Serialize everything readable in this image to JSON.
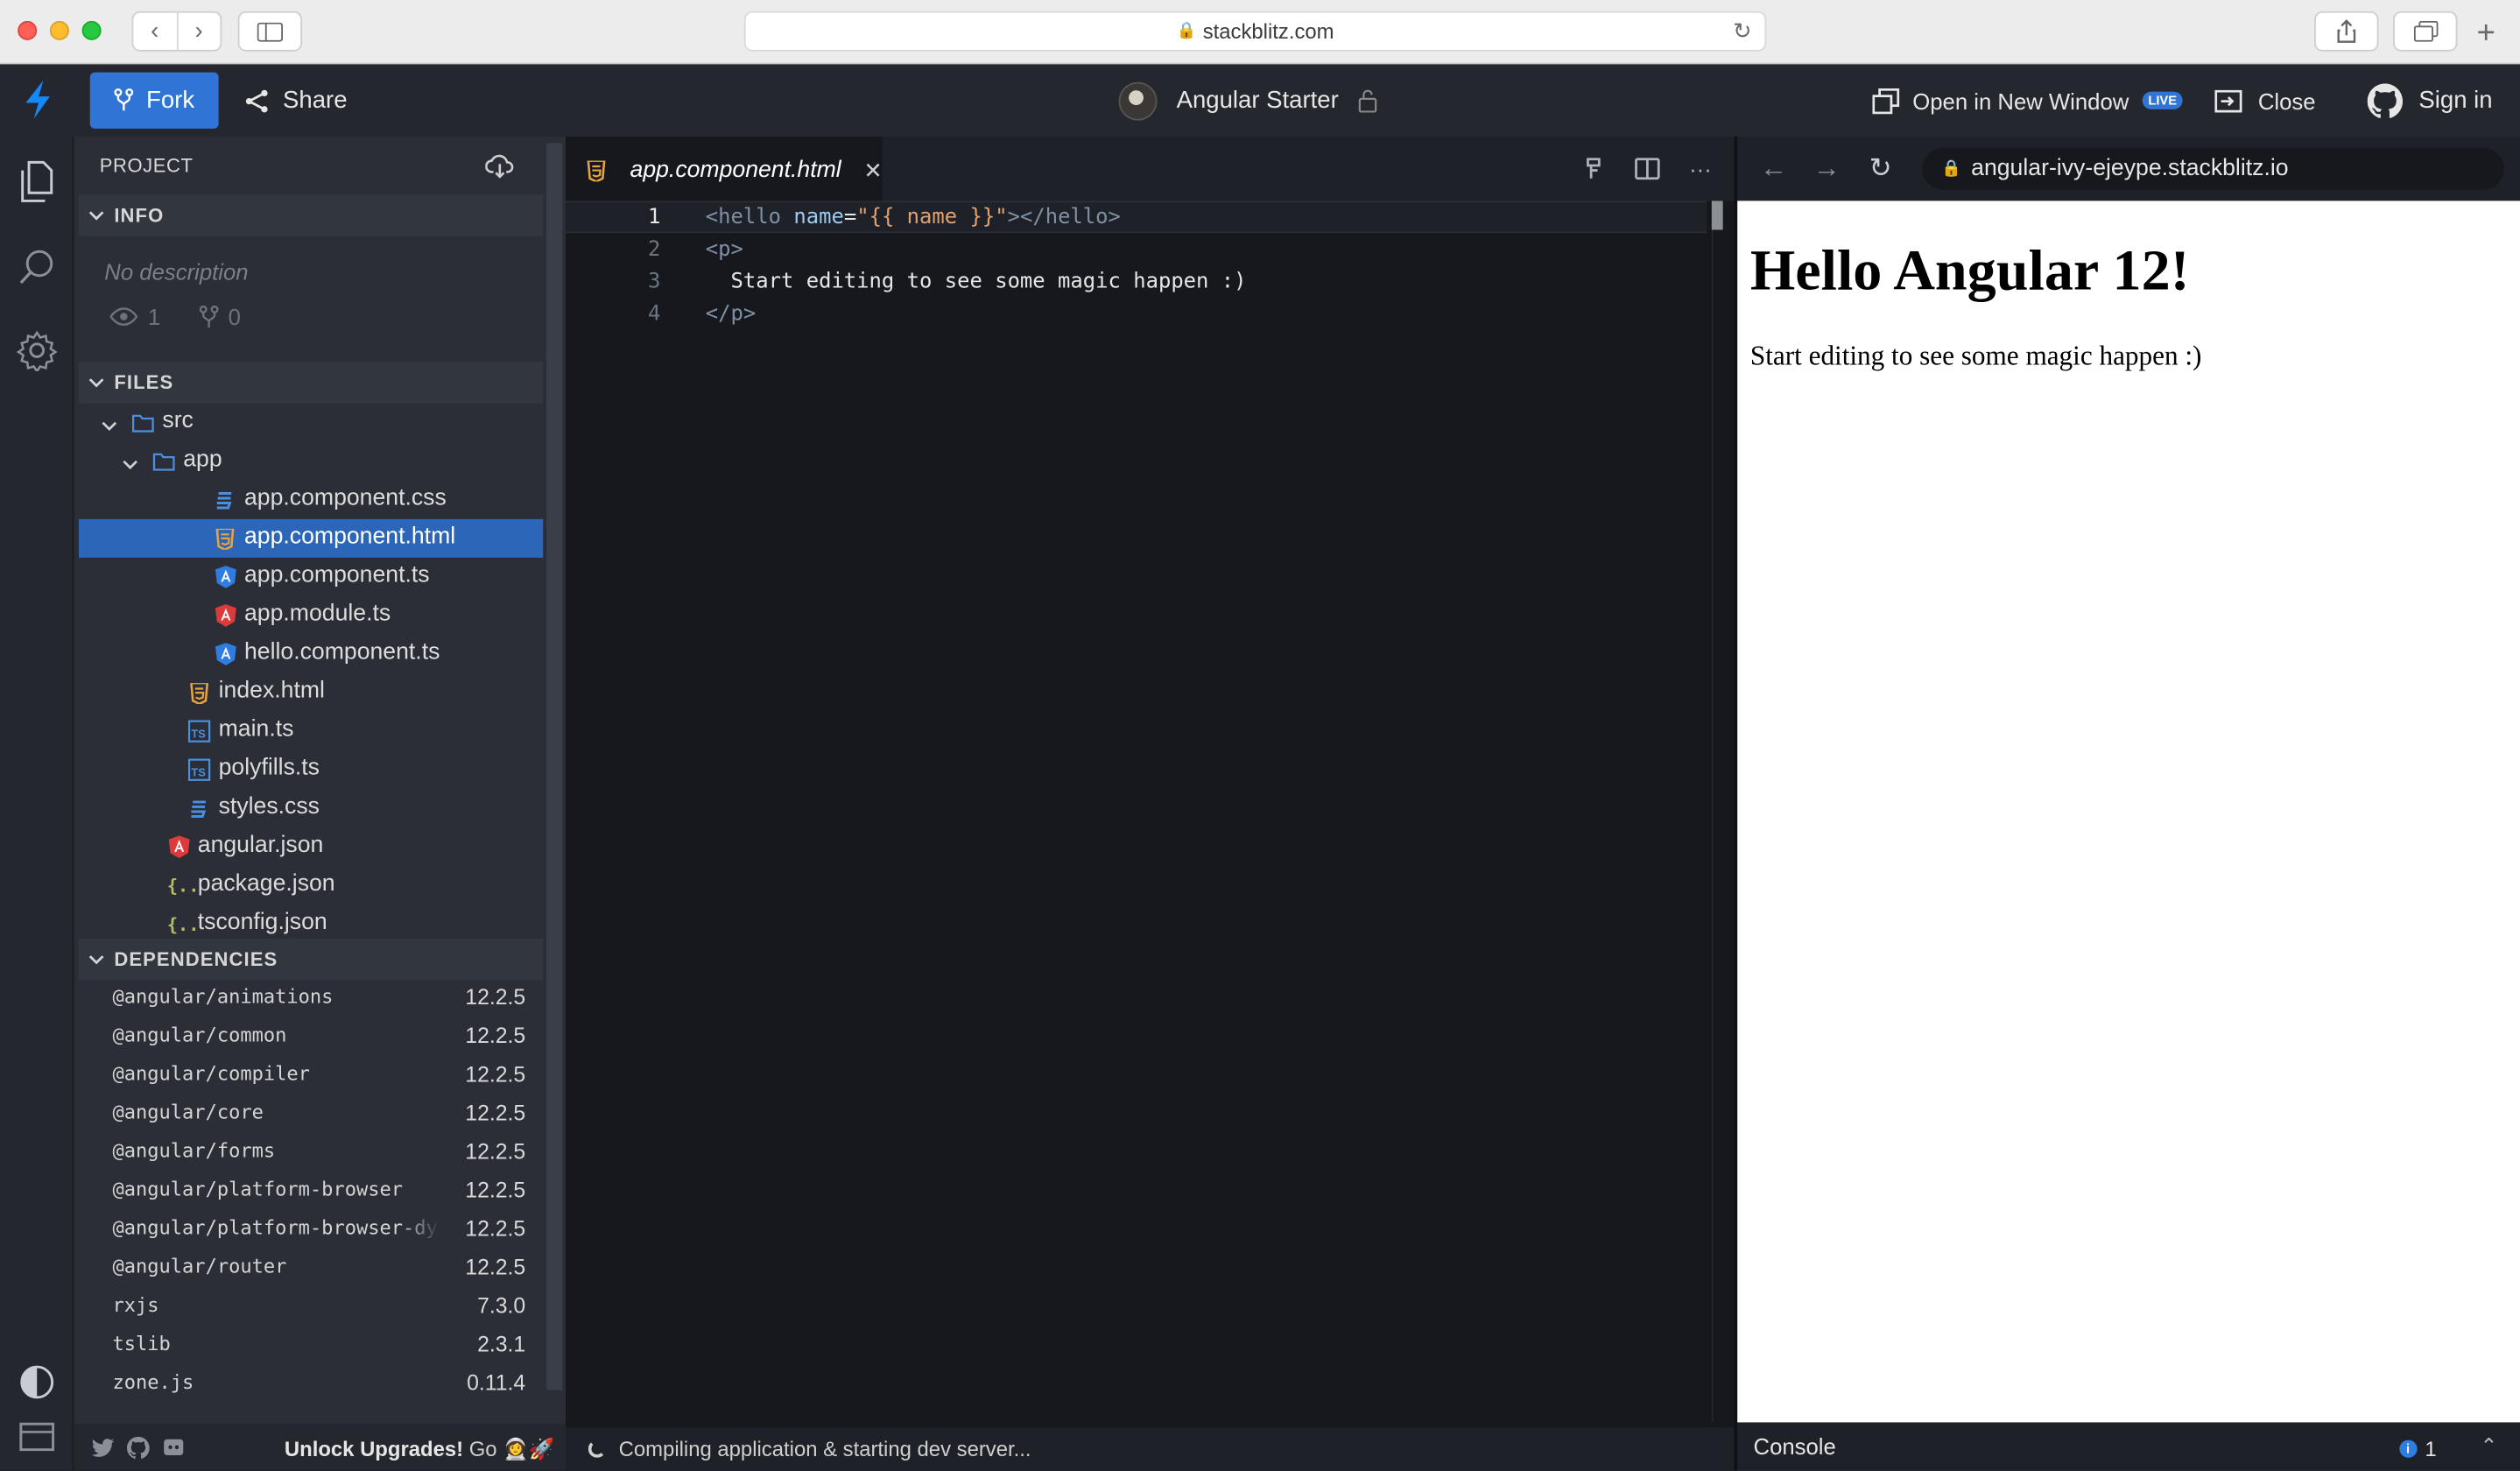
{
  "browser": {
    "url": "stackblitz.com"
  },
  "header": {
    "fork_label": "Fork",
    "share_label": "Share",
    "project_title": "Angular Starter",
    "open_new_window_label": "Open in New Window",
    "live_badge": "LIVE",
    "close_label": "Close",
    "sign_in_label": "Sign in"
  },
  "sidebar": {
    "project_label": "PROJECT",
    "info": {
      "title": "INFO",
      "description": "No description",
      "views": "1",
      "forks": "0"
    },
    "files": {
      "title": "FILES",
      "items": [
        {
          "label": "src",
          "icon": "folder-icon"
        },
        {
          "label": "app",
          "icon": "folder-icon"
        },
        {
          "label": "app.component.css",
          "icon": "css-file-icon"
        },
        {
          "label": "app.component.html",
          "icon": "html-file-icon"
        },
        {
          "label": "app.component.ts",
          "icon": "angular-component-icon"
        },
        {
          "label": "app.module.ts",
          "icon": "angular-module-icon"
        },
        {
          "label": "hello.component.ts",
          "icon": "angular-component-icon"
        },
        {
          "label": "index.html",
          "icon": "html-file-icon"
        },
        {
          "label": "main.ts",
          "icon": "typescript-file-icon"
        },
        {
          "label": "polyfills.ts",
          "icon": "typescript-file-icon"
        },
        {
          "label": "styles.css",
          "icon": "css-file-icon"
        },
        {
          "label": "angular.json",
          "icon": "angular-config-icon"
        },
        {
          "label": "package.json",
          "icon": "json-file-icon"
        },
        {
          "label": "tsconfig.json",
          "icon": "json-file-icon"
        }
      ]
    },
    "dependencies": {
      "title": "DEPENDENCIES",
      "items": [
        {
          "name": "@angular/animations",
          "version": "12.2.5"
        },
        {
          "name": "@angular/common",
          "version": "12.2.5"
        },
        {
          "name": "@angular/compiler",
          "version": "12.2.5"
        },
        {
          "name": "@angular/core",
          "version": "12.2.5"
        },
        {
          "name": "@angular/forms",
          "version": "12.2.5"
        },
        {
          "name": "@angular/platform-browser",
          "version": "12.2.5"
        },
        {
          "name": "@angular/platform-browser-dynamic",
          "version": "12.2.5"
        },
        {
          "name": "@angular/router",
          "version": "12.2.5"
        },
        {
          "name": "rxjs",
          "version": "7.3.0"
        },
        {
          "name": "tslib",
          "version": "2.3.1"
        },
        {
          "name": "zone.js",
          "version": "0.11.4"
        }
      ]
    },
    "footer": {
      "unlock_bold": "Unlock Upgrades!",
      "unlock_go": "Go",
      "unlock_emoji": "👩‍🚀🚀"
    }
  },
  "editor": {
    "tab_label": "app.component.html",
    "lines": [
      {
        "num": "1",
        "html": true
      },
      {
        "num": "2"
      },
      {
        "num": "3"
      },
      {
        "num": "4"
      }
    ],
    "line1": {
      "open_lt": "<",
      "tag": "hello",
      "attr": "name",
      "eq": "=",
      "str": "\"{{ name }}\"",
      "close": ">",
      "end_tag": "</hello>"
    },
    "line2": "<p>",
    "line3": "  Start editing to see some magic happen :)",
    "line4": "</p>",
    "status_text": "Compiling application & starting dev server..."
  },
  "preview": {
    "url": "angular-ivy-ejeype.stackblitz.io",
    "heading": "Hello Angular 12!",
    "paragraph": "Start editing to see some magic happen :)",
    "console_label": "Console",
    "console_count": "1"
  },
  "colors": {
    "accent": "#3075d6",
    "selected_row": "#2c66b8",
    "editor_bg": "#16181d",
    "sidebar_bg": "#2b2e36"
  }
}
